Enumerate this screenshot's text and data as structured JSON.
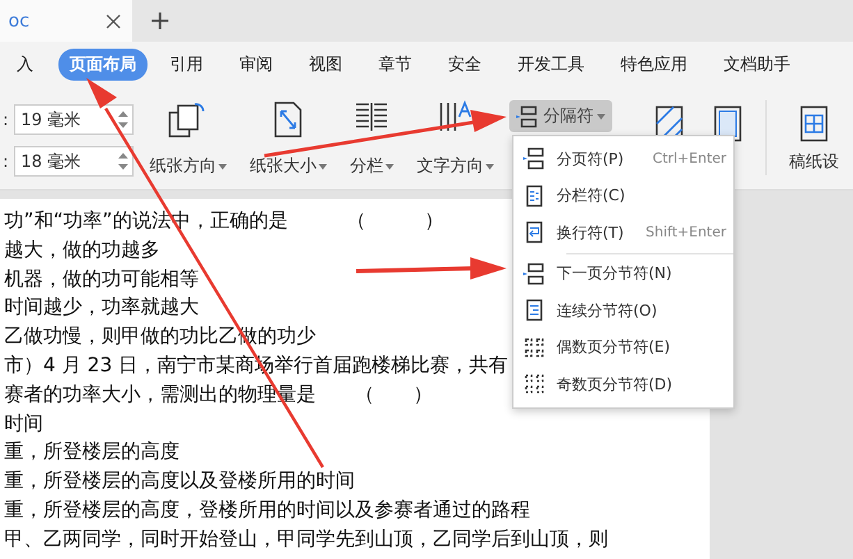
{
  "document_tab": {
    "title": "oc"
  },
  "ribbon_tabs": [
    {
      "label": "入",
      "selected": false
    },
    {
      "label": "页面布局",
      "selected": true
    },
    {
      "label": "引用",
      "selected": false
    },
    {
      "label": "审阅",
      "selected": false
    },
    {
      "label": "视图",
      "selected": false
    },
    {
      "label": "章节",
      "selected": false
    },
    {
      "label": "安全",
      "selected": false
    },
    {
      "label": "开发工具",
      "selected": false
    },
    {
      "label": "特色应用",
      "selected": false
    },
    {
      "label": "文档助手",
      "selected": false
    }
  ],
  "margins": [
    {
      "label": ":",
      "value": "19 毫米"
    },
    {
      "label": ":",
      "value": "18 毫米"
    }
  ],
  "tools": [
    {
      "kind": "orientation",
      "label": "纸张方向"
    },
    {
      "kind": "size",
      "label": "纸张大小"
    },
    {
      "kind": "columns",
      "label": "分栏"
    },
    {
      "kind": "direction",
      "label": "文字方向"
    }
  ],
  "break_button": {
    "label": "分隔符",
    "pressed": true
  },
  "extra_tools": [
    {
      "kind": "background"
    },
    {
      "kind": "border"
    },
    {
      "kind": "grid",
      "label": "稿纸设"
    }
  ],
  "menu": {
    "groups": [
      [
        {
          "kind": "page",
          "label": "分页符(P)",
          "shortcut": "Ctrl+Enter"
        },
        {
          "kind": "column",
          "label": "分栏符(C)"
        },
        {
          "kind": "wrap",
          "label": "换行符(T)",
          "shortcut": "Shift+Enter"
        }
      ],
      [
        {
          "kind": "page",
          "label": "下一页分节符(N)"
        },
        {
          "kind": "continuous",
          "label": "连续分节符(O)"
        },
        {
          "kind": "even",
          "label": "偶数页分节符(E)"
        },
        {
          "kind": "odd",
          "label": "奇数页分节符(D)"
        }
      ]
    ]
  },
  "document": {
    "lines": [
      "功”和“功率”的说法中，正确的是　　　（　　　）",
      "越大，做的功越多",
      "机器，做的功可能相等",
      "时间越少，功率就越大",
      "乙做功慢，则甲做的功比乙做的功少",
      "市）4 月 23 日，南宁市某商场举行首届跑楼梯比赛，共有",
      "赛者的功率大小，需测出的物理量是　　（　　）",
      "时间",
      "重，所登楼层的高度",
      "重，所登楼层的高度以及登楼所用的时间",
      "重，所登楼层的高度，登楼所用的时间以及参赛者通过的路程",
      "甲、乙两同学，同时开始登山，甲同学先到山顶，乙同学后到山顶，则"
    ]
  }
}
